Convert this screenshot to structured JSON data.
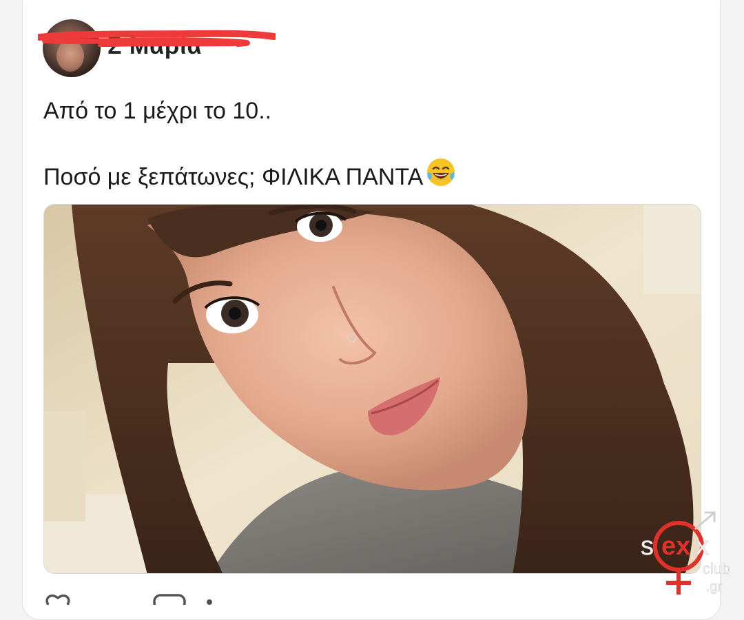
{
  "post": {
    "author_name": "Σ Μαρία",
    "text_line1": "Από το 1 μέχρι το 10..",
    "text_line2": "Ποσό με ξεπάτωνες; ΦΙΛΙΚΑ ΠΑΝΤΑ",
    "emoji": "laughing-tears-emoji"
  },
  "watermark": {
    "brand_prefix": "s",
    "brand_main": "ex",
    "brand_sub": "club",
    "brand_domain": ".gr",
    "brand_color": "#e0312b"
  },
  "colors": {
    "redaction": "#ee3a3a",
    "text": "#1a1a1a"
  }
}
